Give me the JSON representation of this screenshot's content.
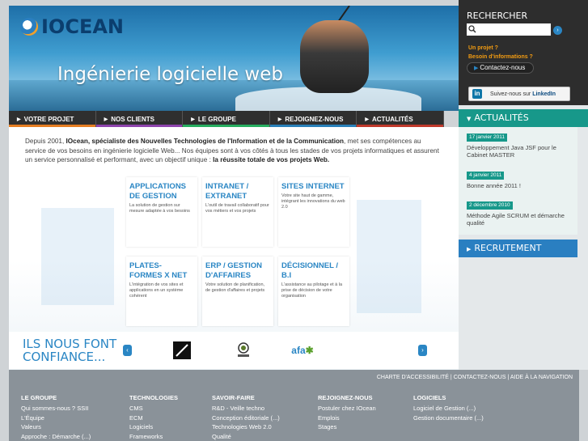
{
  "brand": {
    "logo_text": "IOCEAN",
    "tagline": "Ingénierie logicielle web"
  },
  "nav": [
    {
      "label": "VOTRE PROJET"
    },
    {
      "label": "NOS CLIENTS"
    },
    {
      "label": "LE GROUPE"
    },
    {
      "label": "REJOIGNEZ-NOUS"
    },
    {
      "label": "ACTUALITÉS"
    }
  ],
  "intro": {
    "p1": "Depuis 2001, ",
    "b1": "IOcean, spécialiste des Nouvelles Technologies de l'Information et de la Communication",
    "p2": ", met ses compétences au service de vos besoins en ingénierie logicielle Web... Nos équipes sont à vos côtés à tous les stades de vos projets informatiques et assurent un service personnalisé et performant, avec un objectif unique : ",
    "b2": "la réussite totale de vos projets Web."
  },
  "blocks": [
    {
      "title": "APPLICATIONS DE GESTION",
      "desc": "La solution de gestion sur mesure adaptée à vos besoins"
    },
    {
      "title": "INTRANET / EXTRANET",
      "desc": "L'outil de travail collaboratif pour vos métiers et vos projets"
    },
    {
      "title": "SITES INTERNET",
      "desc": "Votre site haut de gamme, intégrant les innovations du web 2.0"
    },
    {
      "title": "PLATES-FORMES X NET",
      "desc": "L'intégration de vos sites et applications en un système cohérent"
    },
    {
      "title": "ERP / GESTION D'AFFAIRES",
      "desc": "Votre solution de planification, de gestion d'affaires et projets"
    },
    {
      "title": "DÉCISIONNEL / B.I",
      "desc": "L'assistance au pilotage et à la prise de décision de votre organisation"
    }
  ],
  "confiance": {
    "title_line1": "ILS NOUS FONT",
    "title_line2": "CONFIANCE...",
    "partners": [
      "afa"
    ]
  },
  "sidebar": {
    "search_title": "RECHERCHER",
    "search_value": "",
    "question1": "Un projet ?",
    "question2": "Besoin d'informations ?",
    "contact_label": "Contactez-nous",
    "linkedin_prefix": "Suivez-nous sur",
    "linkedin_brand": "LinkedIn",
    "news_title": "ACTUALITÉS",
    "news": [
      {
        "date": "17 janvier 2011",
        "text": "Développement Java JSF pour le Cabinet MASTER"
      },
      {
        "date": "4 janvier 2011",
        "text": "Bonne année 2011 !"
      },
      {
        "date": "2 décembre 2010",
        "text": "Méthode Agile SCRUM et démarche qualité"
      }
    ],
    "recruitment_title": "RECRUTEMENT"
  },
  "footer": {
    "links": [
      "CHARTE D'ACCESSIBILITÉ",
      "CONTACTEZ-NOUS",
      "AIDE À LA NAVIGATION"
    ],
    "columns": [
      {
        "title": "LE GROUPE",
        "items": [
          "Qui sommes-nous ? SSII",
          "L'Équipe",
          "Valeurs",
          "Approche : Démarche (...)"
        ]
      },
      {
        "title": "TECHNOLOGIES",
        "items": [
          "CMS",
          "ECM",
          "Logiciels",
          "Frameworks"
        ]
      },
      {
        "title": "SAVOIR-FAIRE",
        "items": [
          "R&D - Veille techno",
          "Conception éditoriale (...)",
          "Technologies Web 2.0",
          "Qualité"
        ]
      },
      {
        "title": "REJOIGNEZ-NOUS",
        "items": [
          "Postuler chez IOcean",
          "Emplois",
          "Stages"
        ]
      },
      {
        "title": "LOGICIELS",
        "items": [
          "Logiciel de Gestion (...)",
          "Gestion documentaire (...)"
        ]
      }
    ]
  },
  "colors": {
    "accent_blue": "#2a86c4",
    "teal": "#17988a",
    "orange": "#f39c12",
    "dark": "#2d2d2d"
  }
}
